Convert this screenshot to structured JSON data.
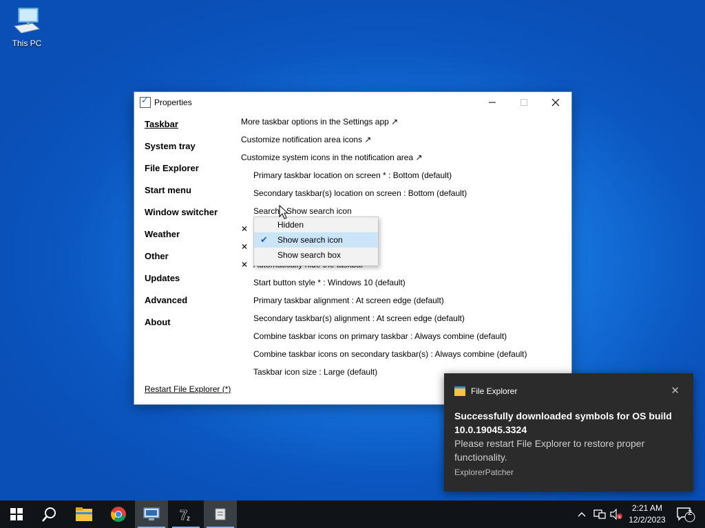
{
  "desktop": {
    "icon_label": "This PC",
    "icon": "computer-icon"
  },
  "window": {
    "title": "Properties",
    "nav": [
      "Taskbar",
      "System tray",
      "File Explorer",
      "Start menu",
      "Window switcher",
      "Weather",
      "Other",
      "Updates",
      "Advanced",
      "About"
    ],
    "restart_link": "Restart File Explorer (*)",
    "links": [
      "More taskbar options in the Settings app ↗",
      "Customize notification area icons ↗",
      "Customize system icons in the notification area ↗"
    ],
    "settings_top": [
      "Primary taskbar location on screen * : Bottom (default)",
      "Secondary taskbar(s) location on screen : Bottom (default)",
      "Search : Show search icon"
    ],
    "hidden_row_text": "Automatically hide the taskbar",
    "settings_bottom": [
      "Start button style * : Windows 10 (default)",
      "Primary taskbar alignment : At screen edge (default)",
      "Secondary taskbar(s) alignment : At screen edge (default)",
      "Combine taskbar icons on primary taskbar : Always combine (default)",
      "Combine taskbar icons on secondary taskbar(s) : Always combine (default)",
      "Taskbar icon size : Large (default)"
    ],
    "x_mark": "✕"
  },
  "dropdown": {
    "options": [
      "Hidden",
      "Show search icon",
      "Show search box"
    ],
    "selected": "Show search icon"
  },
  "toast": {
    "app": "File Explorer",
    "heading": "Successfully downloaded symbols for OS build 10.0.19045.3324",
    "body": "Please restart File Explorer to restore proper functionality.",
    "source": "ExplorerPatcher"
  },
  "taskbar": {
    "time": "2:21 AM",
    "date": "12/2/2023",
    "notification_count": "2",
    "apps": [
      "start-icon",
      "search-icon",
      "file-explorer-icon",
      "chrome-icon",
      "remote-desktop-icon",
      "7zip-icon",
      "properties-app-icon"
    ]
  }
}
